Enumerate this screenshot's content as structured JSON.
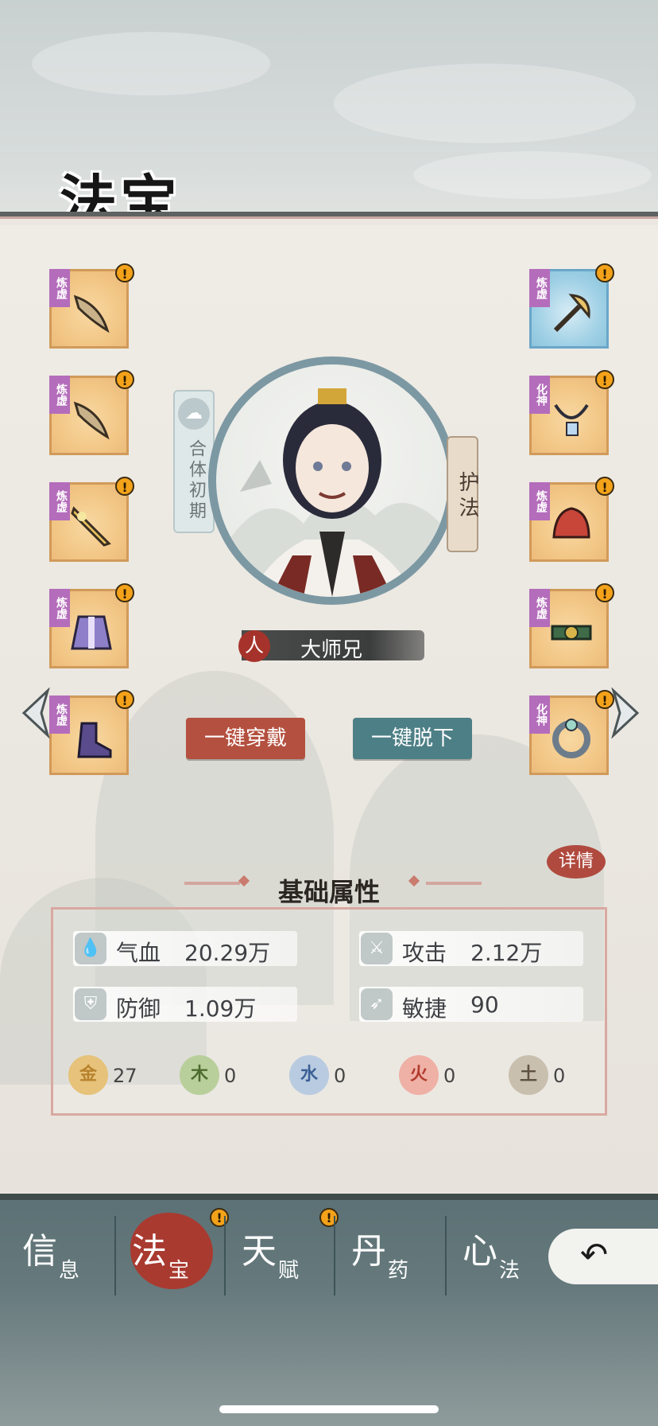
{
  "header": {
    "title": "法宝"
  },
  "left_slots": [
    {
      "tag": "炼虚",
      "alert": "!",
      "item_icon": "curved-blade-icon",
      "frame": "gold"
    },
    {
      "tag": "炼虚",
      "alert": "!",
      "item_icon": "curved-blade-icon",
      "frame": "gold"
    },
    {
      "tag": "炼虚",
      "alert": "!",
      "item_icon": "golden-sword-icon",
      "frame": "gold"
    },
    {
      "tag": "炼虚",
      "alert": "!",
      "item_icon": "robe-armor-icon",
      "frame": "gold"
    },
    {
      "tag": "炼虚",
      "alert": "!",
      "item_icon": "boot-icon",
      "frame": "gold"
    }
  ],
  "right_slots": [
    {
      "tag": "炼虚",
      "alert": "!",
      "item_icon": "fan-staff-icon",
      "frame": "blue"
    },
    {
      "tag": "化神",
      "alert": "!",
      "item_icon": "necklace-icon",
      "frame": "gold"
    },
    {
      "tag": "炼虚",
      "alert": "!",
      "item_icon": "red-helmet-icon",
      "frame": "gold"
    },
    {
      "tag": "炼虚",
      "alert": "!",
      "item_icon": "belt-icon",
      "frame": "gold"
    },
    {
      "tag": "化神",
      "alert": "!",
      "item_icon": "ring-icon",
      "frame": "gold"
    }
  ],
  "character": {
    "realm": "合体初期",
    "guard_label": "护法",
    "seal": "人",
    "name": "大师兄"
  },
  "actions": {
    "equip_all": "一键穿戴",
    "unequip_all": "一键脱下",
    "details": "详情"
  },
  "attributes": {
    "section_title": "基础属性",
    "stats": [
      {
        "label": "气血",
        "value": "20.29万",
        "icon": "blood-drop-icon"
      },
      {
        "label": "攻击",
        "value": "2.12万",
        "icon": "attack-icon"
      },
      {
        "label": "防御",
        "value": "1.09万",
        "icon": "shield-icon"
      },
      {
        "label": "敏捷",
        "value": "90",
        "icon": "wing-icon"
      }
    ],
    "elements": [
      {
        "symbol": "金",
        "value": "27",
        "color": "#e6c27a",
        "fg": "#b8822d"
      },
      {
        "symbol": "木",
        "value": "0",
        "color": "#b9cf9b",
        "fg": "#4e6b2f"
      },
      {
        "symbol": "水",
        "value": "0",
        "color": "#b8cbe0",
        "fg": "#3a5f96"
      },
      {
        "symbol": "火",
        "value": "0",
        "color": "#efb0a6",
        "fg": "#b23b2e"
      },
      {
        "symbol": "土",
        "value": "0",
        "color": "#c9bfae",
        "fg": "#5e5140"
      }
    ]
  },
  "nav": {
    "tabs": [
      {
        "main": "信",
        "sub": "息",
        "active": false,
        "alert": ""
      },
      {
        "main": "法",
        "sub": "宝",
        "active": true,
        "alert": "!"
      },
      {
        "main": "天",
        "sub": "赋",
        "active": false,
        "alert": "!"
      },
      {
        "main": "丹",
        "sub": "药",
        "active": false,
        "alert": ""
      },
      {
        "main": "心",
        "sub": "法",
        "active": false,
        "alert": ""
      }
    ],
    "back_icon": "back-arrow-icon"
  },
  "colors": {
    "accent_red": "#b4503f",
    "accent_teal": "#4d7f86",
    "alert": "#f3a21a"
  }
}
